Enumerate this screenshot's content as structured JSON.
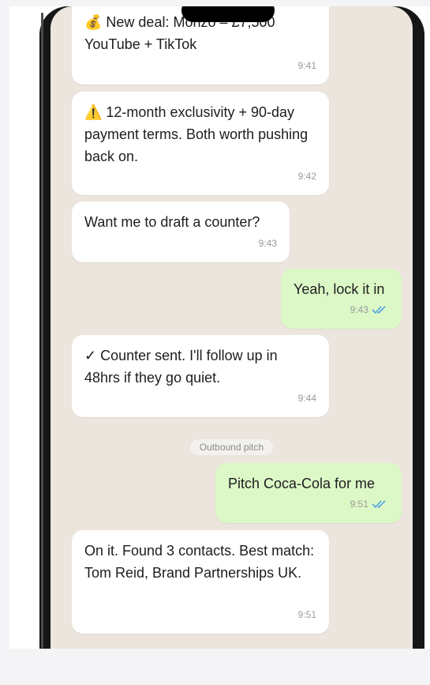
{
  "messages": [
    {
      "dir": "in",
      "text": "💰 New deal: Monzo – £7,500",
      "time": "9:41",
      "hidden": true
    },
    {
      "dir": "in",
      "text": "YouTube + TikTok",
      "time": "9:41"
    },
    {
      "dir": "in",
      "text": "⚠️ 12-month exclusivity + 90-day payment terms. Both worth pushing back on.",
      "time": "9:42"
    },
    {
      "dir": "in",
      "text": "Want me to draft a counter?",
      "time": "9:43"
    },
    {
      "dir": "out",
      "text": "Yeah, lock it in",
      "time": "9:43"
    },
    {
      "dir": "in",
      "text": "✓ Counter sent. I'll follow up in 48hrs if they go quiet.",
      "time": "9:44"
    },
    {
      "dir": "out",
      "text": "Pitch Coca-Cola for me",
      "time": "9:51"
    },
    {
      "dir": "in",
      "text": "On it. Found 3 contacts. Best match: Tom Reid, Brand Partnerships UK.",
      "time": "9:51"
    }
  ],
  "divider": {
    "label": "Outbound pitch"
  },
  "colors": {
    "incoming": "#ffffff",
    "outgoing": "#dcf8c6",
    "wallpaper": "#ece5dd",
    "read_ticks": "#4fa3e0"
  },
  "icons": {
    "read": "double-check-icon"
  }
}
